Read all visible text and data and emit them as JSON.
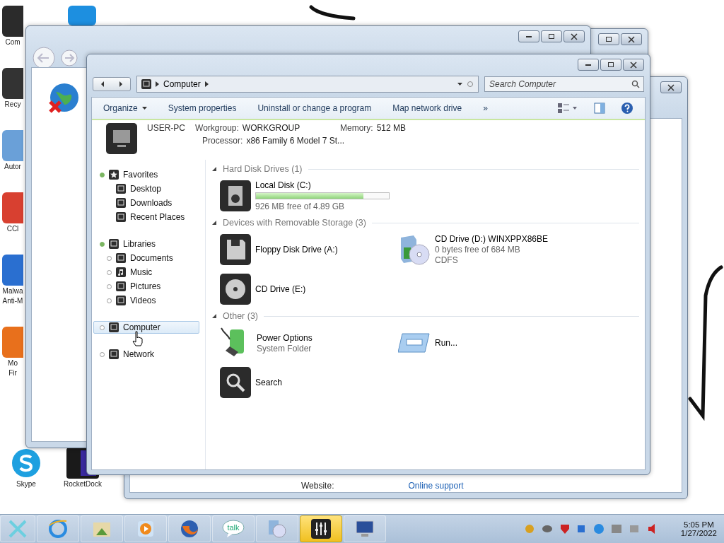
{
  "desktop_icons": [
    {
      "lines": [
        "Com"
      ]
    },
    {
      "lines": [
        "Recy"
      ]
    },
    {
      "lines": [
        "Autor"
      ]
    },
    {
      "lines": [
        "CCl"
      ]
    },
    {
      "lines": [
        "Malwa",
        "Anti-M"
      ]
    },
    {
      "lines": [
        "Mo",
        "Fir"
      ]
    }
  ],
  "desktop_bottom_icons": [
    {
      "kind": "skype",
      "lines": [
        "Skype"
      ]
    },
    {
      "kind": "dock",
      "lines": [
        "RocketDock"
      ]
    }
  ],
  "back_window": {
    "fields": [
      {
        "label": "Website:",
        "link": "Online support"
      }
    ]
  },
  "explorer": {
    "path": [
      "Computer"
    ],
    "search": {
      "placeholder": "Search Computer"
    },
    "toolbar": [
      {
        "label": "Organize",
        "dropdown": true
      },
      {
        "label": "System properties",
        "dropdown": false
      },
      {
        "label": "Uninstall or change a program",
        "dropdown": false
      },
      {
        "label": "Map network drive",
        "dropdown": false
      },
      {
        "label": "»",
        "dropdown": false
      }
    ],
    "details": {
      "name": "USER-PC",
      "rows": [
        [
          {
            "label": "Workgroup:",
            "value": "WORKGROUP"
          },
          {
            "label": "Memory:",
            "value": "512 MB"
          }
        ],
        [
          {
            "label": "Processor:",
            "value": "x86 Family 6 Model 7 St..."
          }
        ]
      ]
    },
    "sidebar": [
      {
        "label": "Favorites",
        "kind": "star",
        "expanded": true,
        "selected": false,
        "children": [
          {
            "label": "Desktop",
            "kind": "desktop",
            "selected": false
          },
          {
            "label": "Downloads",
            "kind": "download",
            "selected": false
          },
          {
            "label": "Recent Places",
            "kind": "recent",
            "selected": false
          }
        ]
      },
      {
        "label": "Libraries",
        "kind": "library",
        "expanded": true,
        "selected": false,
        "children": [
          {
            "label": "Documents",
            "kind": "document",
            "expanded": false,
            "selected": false
          },
          {
            "label": "Music",
            "kind": "music",
            "expanded": false,
            "selected": false
          },
          {
            "label": "Pictures",
            "kind": "picture",
            "expanded": false,
            "selected": false
          },
          {
            "label": "Videos",
            "kind": "video",
            "expanded": false,
            "selected": false
          }
        ]
      },
      {
        "label": "Computer",
        "kind": "computer",
        "expanded": false,
        "selected": true
      },
      {
        "label": "Network",
        "kind": "network",
        "expanded": false,
        "selected": false
      }
    ],
    "sections": [
      {
        "title": "Hard Disk Drives (1)",
        "expanded": true,
        "items": [
          {
            "kind": "hdd",
            "name": "Local Disk (C:)",
            "level": 0.81,
            "lines": [
              "926 MB free of 4.89 GB"
            ]
          }
        ]
      },
      {
        "title": "Devices with Removable Storage (3)",
        "expanded": true,
        "items": [
          {
            "kind": "floppy",
            "name": "Floppy Disk Drive (A:)"
          },
          {
            "kind": "cd-media",
            "name": "CD Drive (D:) WINXPPX86BE",
            "lines": [
              "0 bytes free of 684 MB",
              "CDFS"
            ]
          },
          {
            "kind": "cd",
            "name": "CD Drive (E:)"
          }
        ]
      },
      {
        "title": "Other (3)",
        "expanded": true,
        "items": [
          {
            "kind": "power",
            "name": "Power Options",
            "lines": [
              "System Folder"
            ]
          },
          {
            "kind": "run",
            "name": "Run..."
          },
          {
            "kind": "search",
            "name": "Search"
          }
        ]
      }
    ]
  },
  "taskbar": {
    "apps": [
      {
        "kind": "browser",
        "selected": false
      },
      {
        "kind": "photos",
        "selected": false
      },
      {
        "kind": "media",
        "selected": false
      },
      {
        "kind": "fox",
        "selected": false
      },
      {
        "kind": "talk",
        "label": "talk",
        "selected": false
      },
      {
        "kind": "disc",
        "selected": false
      },
      {
        "kind": "mixer",
        "selected": true
      },
      {
        "kind": "monitor",
        "selected": false
      }
    ],
    "time": "5:05 PM",
    "date": "1/27/2022"
  }
}
